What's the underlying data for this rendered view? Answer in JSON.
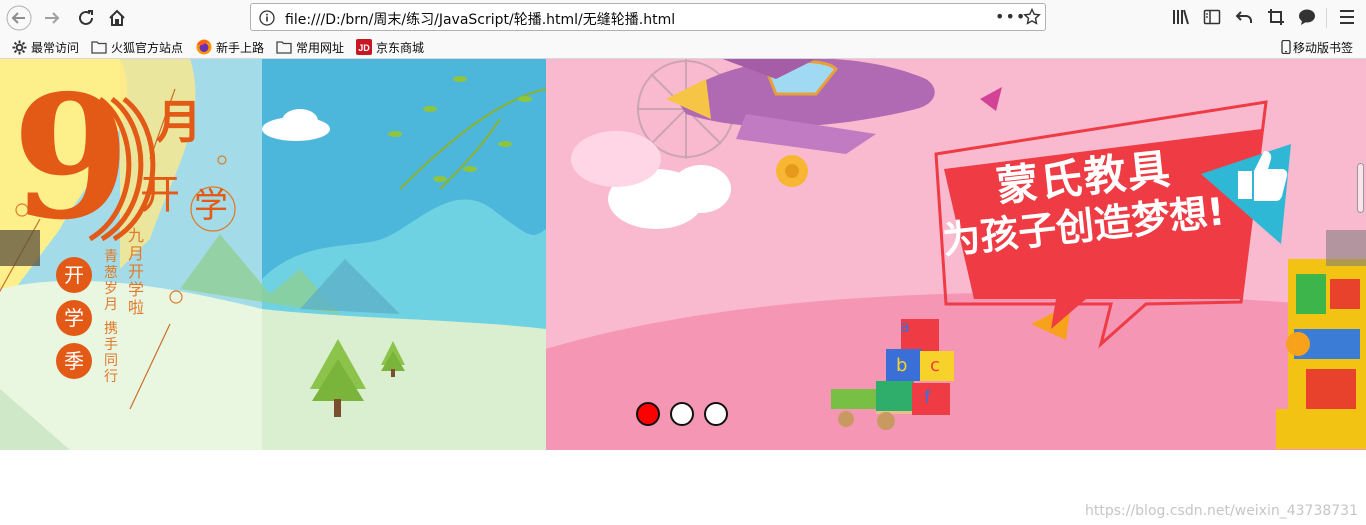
{
  "browser": {
    "url": "file:///D:/brn/周末/练习/JavaScript/轮播.html/无缝轮播.html",
    "page_actions": "•••"
  },
  "bookmarks": {
    "items": [
      {
        "label": "最常访问",
        "icon": "gear-icon"
      },
      {
        "label": "火狐官方站点",
        "icon": "folder-icon"
      },
      {
        "label": "新手上路",
        "icon": "firefox-icon"
      },
      {
        "label": "常用网址",
        "icon": "folder-icon"
      },
      {
        "label": "京东商城",
        "icon": "jd-icon"
      }
    ],
    "mobile": "移动版书签"
  },
  "slide1": {
    "month_number": "9",
    "month_char": "月",
    "kai": "开",
    "xue": "学",
    "seal": [
      "开",
      "学",
      "季"
    ],
    "line1": "青葱岁月",
    "line2": "携手同行",
    "line3": "九月开学啦"
  },
  "slide2": {
    "title": "蒙氏教具",
    "subtitle": "为孩子创造梦想!",
    "blocks": [
      "a",
      "b",
      "c",
      "f"
    ]
  },
  "carousel": {
    "active_index": 0,
    "dot_count": 3
  },
  "footer": {
    "watermark": "https://blog.csdn.net/weixin_43738731"
  }
}
